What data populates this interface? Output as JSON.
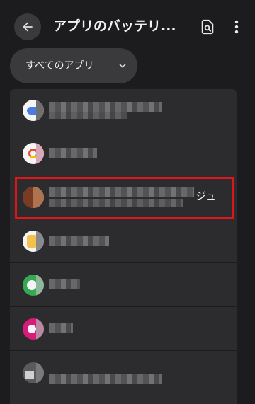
{
  "appbar": {
    "title": "アプリのバッテリ...",
    "back_icon": "arrow-back-icon",
    "search_icon": "search-in-page-icon",
    "more_icon": "more-vert-icon"
  },
  "filter": {
    "label": "すべてのアプリ",
    "icon": "chevron-down-icon"
  },
  "apps": [
    {
      "icon_color": "#4a7de0"
    },
    {
      "icon_color": "#e84a3c"
    },
    {
      "icon_color": "#a0522d",
      "visible_suffix": "ジュ",
      "highlighted": true
    },
    {
      "icon_color": "#f2c14e"
    },
    {
      "icon_color": "#34a853"
    },
    {
      "icon_color": "#d81b7a"
    },
    {
      "icon_color": "#555555"
    }
  ],
  "highlight_color": "#e0141b"
}
